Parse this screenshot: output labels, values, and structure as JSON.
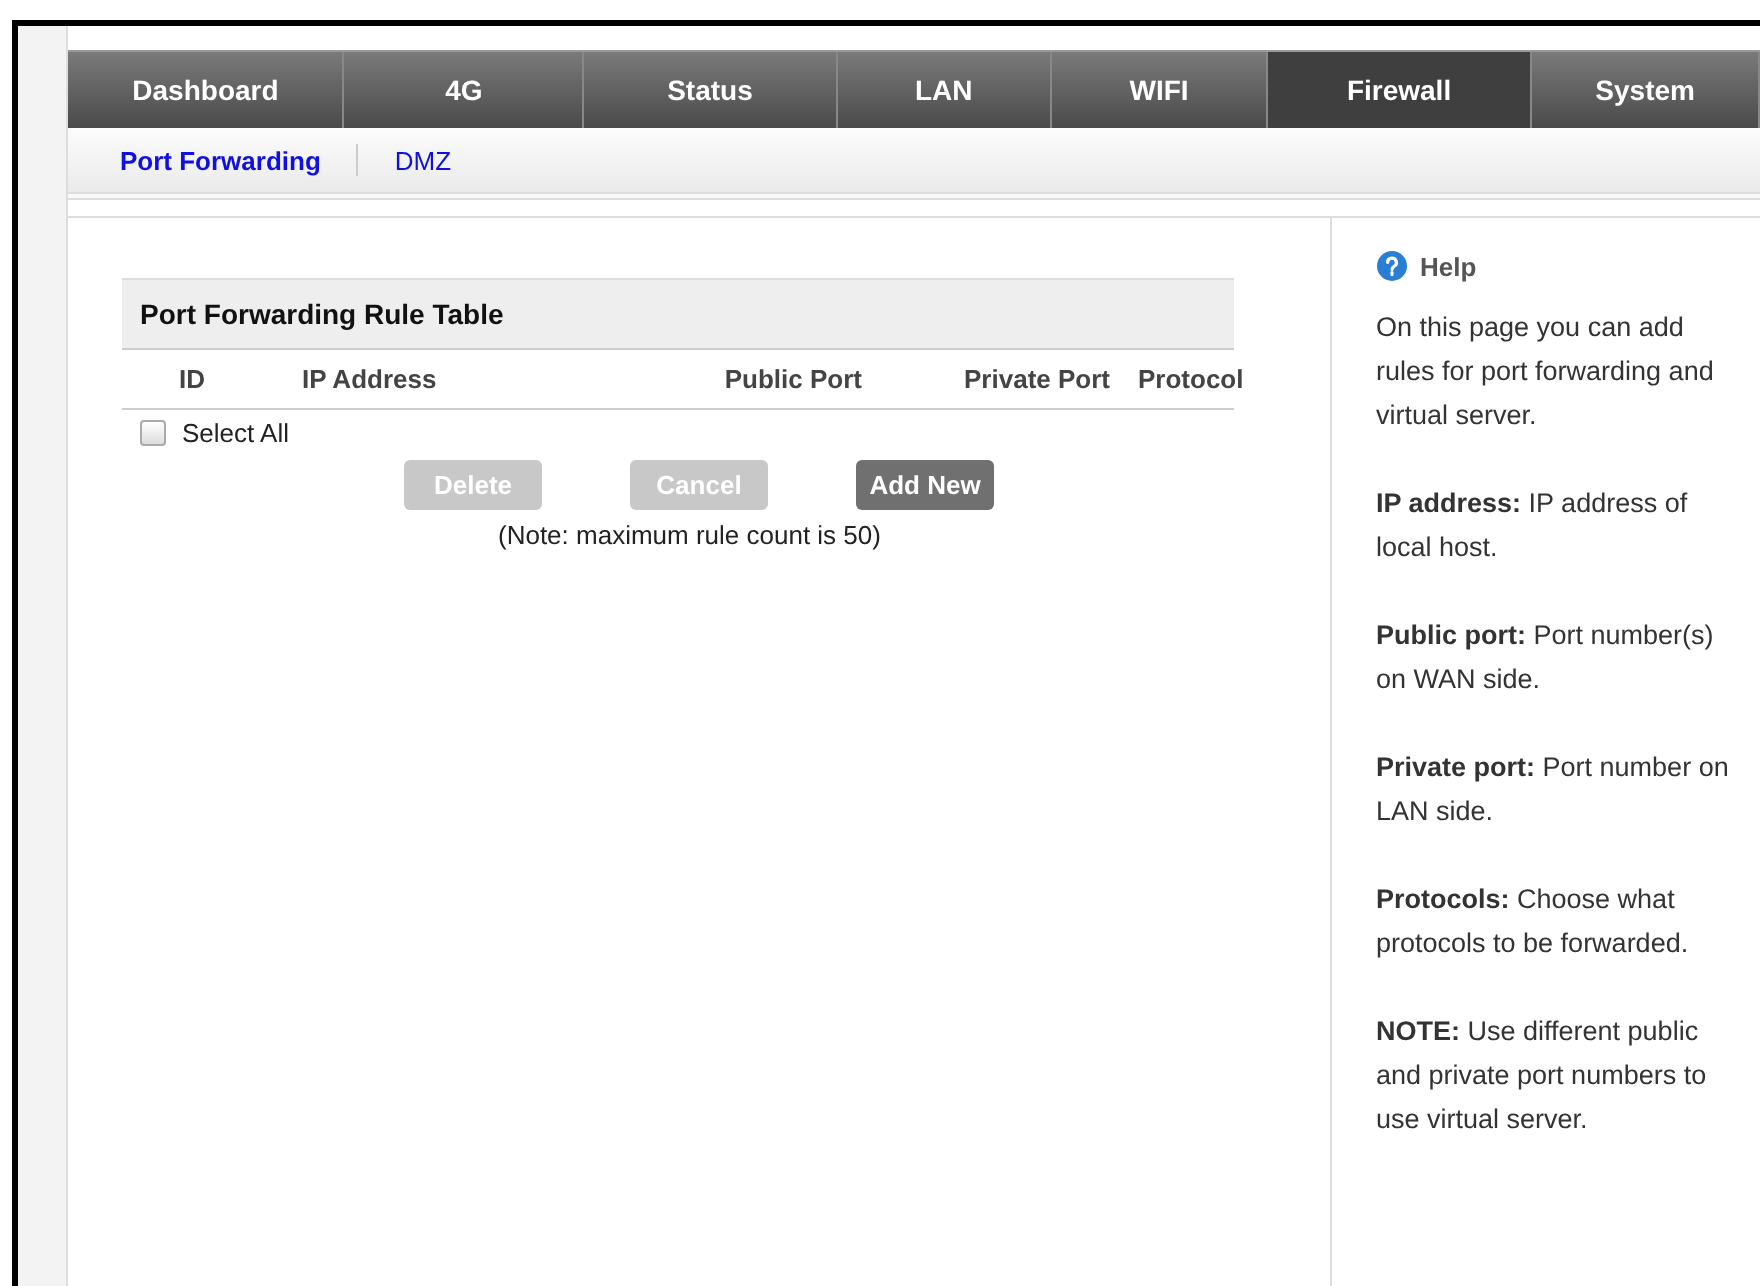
{
  "nav_tabs": [
    {
      "label": "Dashboard",
      "selected": false
    },
    {
      "label": "4G",
      "selected": false
    },
    {
      "label": "Status",
      "selected": false
    },
    {
      "label": "LAN",
      "selected": false
    },
    {
      "label": "WIFI",
      "selected": false
    },
    {
      "label": "Firewall",
      "selected": true
    },
    {
      "label": "System",
      "selected": false
    }
  ],
  "sub_tabs": [
    {
      "label": "Port Forwarding",
      "selected": true
    },
    {
      "label": "DMZ",
      "selected": false
    }
  ],
  "table": {
    "title": "Port Forwarding Rule Table",
    "columns": [
      "ID",
      "IP Address",
      "Public Port",
      "Private Port",
      "Protocol"
    ],
    "select_all": {
      "label": "Select All",
      "checked": false
    }
  },
  "buttons": [
    {
      "label": "Delete",
      "disabled": true
    },
    {
      "label": "Cancel",
      "disabled": true
    },
    {
      "label": "Add New",
      "disabled": false
    }
  ],
  "note": "(Note: maximum rule count is 50)",
  "help": {
    "title": "Help",
    "paragraphs": [
      "On this page you can add rules for port forwarding and virtual server.",
      "**IP address:** IP address of local host.",
      "**Public port:** Port number(s) on WAN side.",
      "**Private port:** Port number on LAN side.",
      "**Protocols:** Choose what protocols to be forwarded.",
      "**NOTE:** Use different public and private port numbers to use virtual server."
    ]
  }
}
